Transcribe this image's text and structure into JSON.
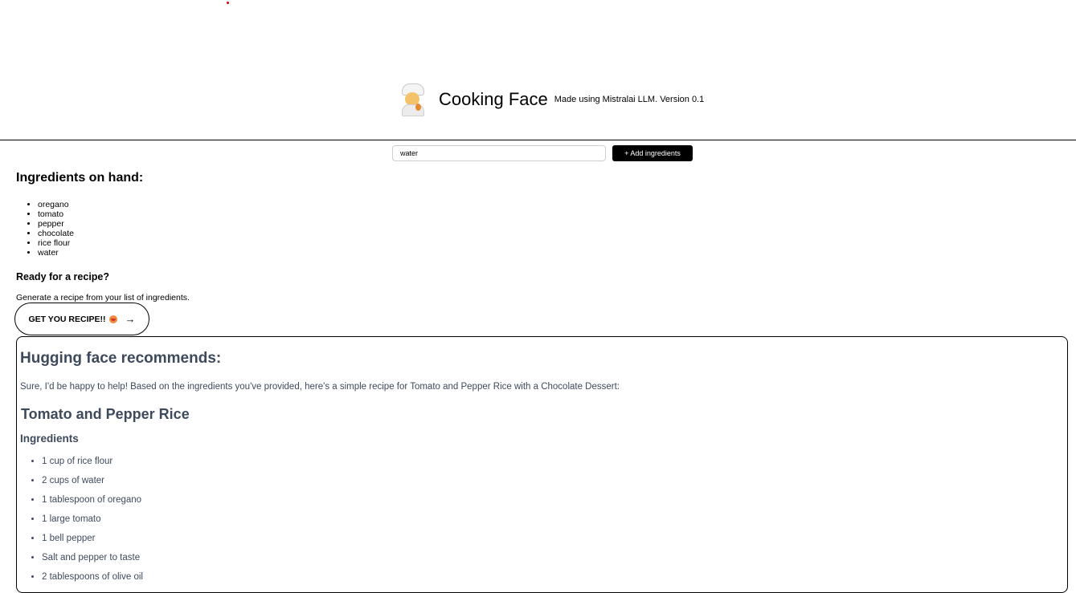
{
  "header": {
    "title": "Cooking Face",
    "tagline": "Made using Mistralai LLM. Version 0.1",
    "logo_icon": "chef-emoji-icon"
  },
  "add_form": {
    "input_value": "water",
    "add_button_label": "+ Add ingredients"
  },
  "ingredients": {
    "heading": "Ingredients on hand:",
    "items": [
      "oregano",
      "tomato",
      "pepper",
      "chocolate",
      "rice flour",
      "water"
    ]
  },
  "ready": {
    "title": "Ready for a recipe?",
    "subtitle": "Generate a recipe from your list of ingredients.",
    "button_label": "GET YOU RECIPE!!",
    "button_emoji_icon": "face-savoring-food-icon",
    "button_arrow_icon": "arrow-right-icon"
  },
  "response": {
    "title": "Hugging face recommends:",
    "intro": "Sure, I'd be happy to help! Based on the ingredients you've provided, here's a simple recipe for Tomato and Pepper Rice with a Chocolate Dessert:",
    "dish_title": "Tomato and Pepper Rice",
    "ingredients_heading": "Ingredients",
    "ingredients": [
      "1 cup of rice flour",
      "2 cups of water",
      "1 tablespoon of oregano",
      "1 large tomato",
      "1 bell pepper",
      "Salt and pepper to taste",
      "2 tablespoons of olive oil"
    ]
  },
  "colors": {
    "response_text": "#3d4a5c",
    "button_dark": "#000000",
    "indicator_dot": "#e00000"
  }
}
